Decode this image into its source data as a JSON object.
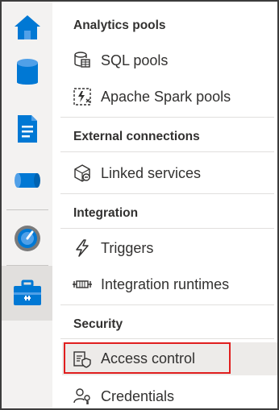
{
  "rail": {
    "items": [
      {
        "name": "home",
        "icon": "home-icon",
        "color": "#0078d4"
      },
      {
        "name": "data",
        "icon": "database-icon",
        "color": "#0078d4"
      },
      {
        "name": "develop",
        "icon": "document-icon",
        "color": "#0078d4"
      },
      {
        "name": "integrate",
        "icon": "pipeline-icon",
        "color": "#0078d4"
      },
      {
        "name": "monitor",
        "icon": "gauge-icon",
        "color": "#0078d4"
      },
      {
        "name": "manage",
        "icon": "toolbox-icon",
        "color": "#0078d4",
        "active": true
      }
    ]
  },
  "sections": {
    "analytics_pools": "Analytics pools",
    "external_connections": "External connections",
    "integration": "Integration",
    "security": "Security"
  },
  "items": {
    "sql_pools": "SQL pools",
    "spark_pools": "Apache Spark pools",
    "linked_services": "Linked services",
    "triggers": "Triggers",
    "integration_runtimes": "Integration runtimes",
    "access_control": "Access control",
    "credentials": "Credentials"
  },
  "colors": {
    "accent": "#0078d4",
    "highlight_border": "#e01e1e",
    "selected_bg": "#edebe9",
    "rail_bg": "#f3f2f1"
  }
}
